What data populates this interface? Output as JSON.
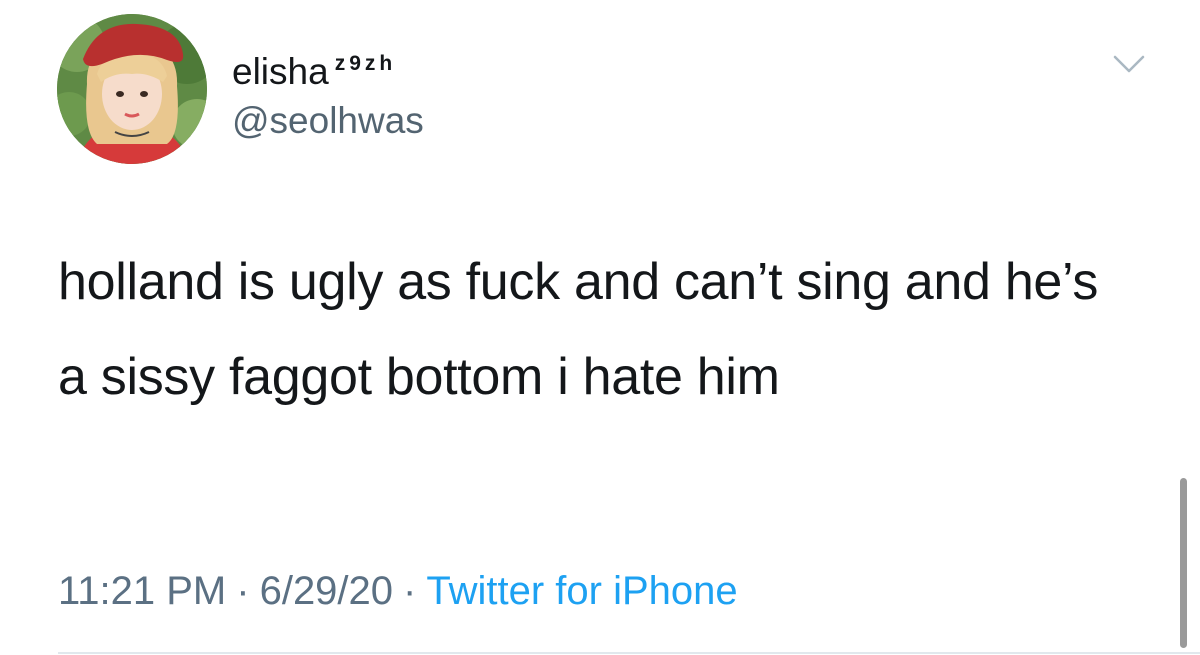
{
  "author": {
    "display_name": "elisha",
    "display_name_superscript": "z9zh",
    "handle": "@seolhwas",
    "avatar_icon": "profile-photo-avatar"
  },
  "menu": {
    "icon": "chevron-down-icon"
  },
  "tweet": {
    "text": "holland is ugly as fuck and can’t sing and he’s a sissy faggot bottom i hate him"
  },
  "meta": {
    "time": "11:21 PM",
    "separator": "·",
    "date": "6/29/20",
    "source": "Twitter for iPhone"
  },
  "colors": {
    "text": "#14171a",
    "secondary": "#5b7083",
    "link": "#1da1f2",
    "divider": "#e1e8ed"
  }
}
